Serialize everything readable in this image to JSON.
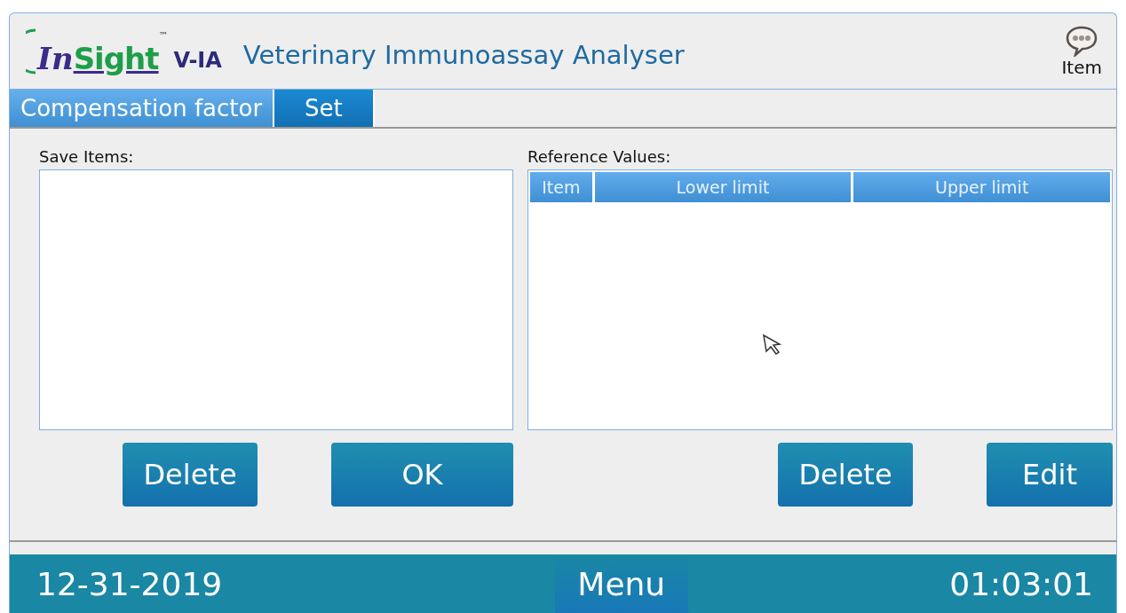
{
  "header": {
    "logo": {
      "part_1": "In",
      "part_2": "Sight",
      "mark": "™",
      "model": "V-IA"
    },
    "title": "Veterinary Immunoassay Analyser",
    "item_button": "Item"
  },
  "tabs": [
    {
      "label": "Compensation factor",
      "selected": false
    },
    {
      "label": "Set",
      "selected": true
    }
  ],
  "save_items": {
    "label": "Save Items:",
    "buttons": [
      "Delete",
      "OK"
    ]
  },
  "reference_values": {
    "label": "Reference Values:",
    "columns": [
      "Item",
      "Lower limit",
      "Upper limit"
    ],
    "buttons": [
      "Delete",
      "Edit"
    ]
  },
  "status_bar": {
    "date": "12-31-2019",
    "menu": "Menu",
    "time": "01:03:01"
  }
}
